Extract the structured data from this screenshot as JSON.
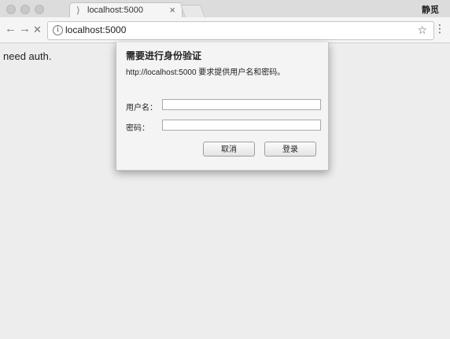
{
  "browser": {
    "tab_title": "localhost:5000",
    "tab_close": "×",
    "profile_name": "静觅",
    "url": "localhost:5000",
    "back": "←",
    "forward": "→",
    "stop": "✕",
    "star": "☆",
    "menu": "⋮",
    "info": "i"
  },
  "page": {
    "body_text": "need auth."
  },
  "auth_dialog": {
    "title": "需要进行身份验证",
    "message": "http://localhost:5000 要求提供用户名和密码。",
    "username_label": "用户名：",
    "username_value": "",
    "password_label": "密码：",
    "password_value": "",
    "cancel_label": "取消",
    "login_label": "登录"
  },
  "colors": {
    "page_bg": "#ededed",
    "dialog_bg": "#f4f4f4"
  }
}
